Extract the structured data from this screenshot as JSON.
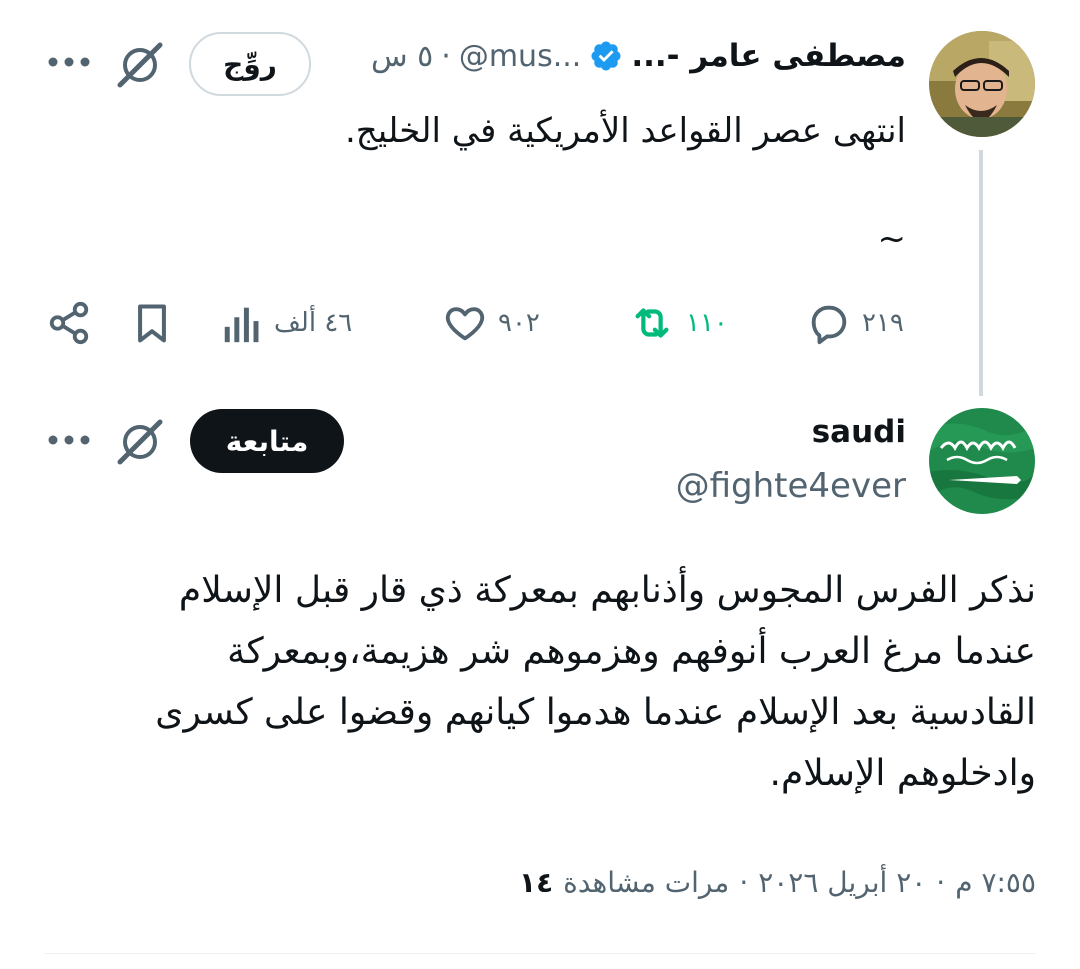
{
  "reply_to": {
    "name": "مصطفى عامر -...",
    "handle": "@mus...",
    "separator": "·",
    "time": "٥ س",
    "action_label": "روِّج",
    "text": "انتهى عصر القواعد الأمريكية في الخليج.",
    "extra_line": "~",
    "metrics": {
      "replies": "٢١٩",
      "reposts": "١١٠",
      "likes": "٩٠٢",
      "views": "٤٦ ألف"
    }
  },
  "reply": {
    "name": "saudi",
    "handle": "@fighte4ever",
    "follow_label": "متابعة",
    "lines": [
      "نذكر الفرس المجوس وأذنابهم بمعركة ذي قار قبل الإسلام",
      "عندما مرغ العرب أنوفهم وهزموهم شر هزيمة،وبمعركة",
      "القادسية بعد الإسلام عندما هدموا كيانهم وقضوا على كسرى",
      "وادخلوهم الإسلام."
    ],
    "meta": {
      "time": "٧:٥٥ م",
      "date": "٢٠ أبريل ٢٠٢٦",
      "views_label": "مرات مشاهدة",
      "views_count": "١٤",
      "separator": "·"
    }
  },
  "colors": {
    "verified": "#1d9bf0",
    "repost_green": "#00ba7c",
    "muted": "#536471",
    "thread_line": "#cfd9de",
    "follow_bg": "#0f1419"
  }
}
